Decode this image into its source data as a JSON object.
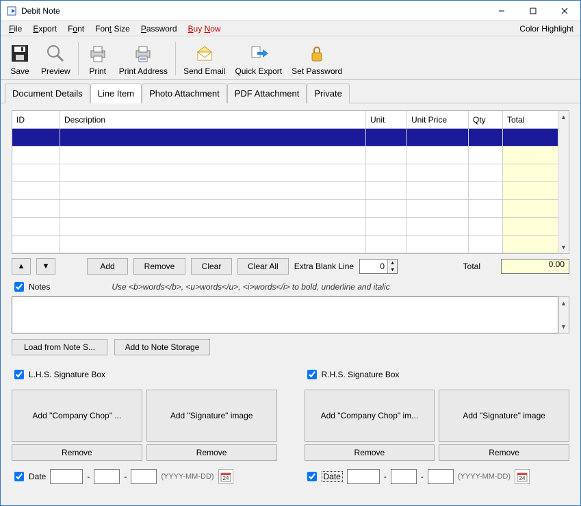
{
  "window": {
    "title": "Debit Note"
  },
  "menu": {
    "file": "File",
    "export": "Export",
    "font": "Font",
    "font_size": "Font Size",
    "password": "Password",
    "buy_now": "Buy Now",
    "color_highlight": "Color Highlight"
  },
  "toolbar": {
    "save": "Save",
    "preview": "Preview",
    "print": "Print",
    "print_address": "Print Address",
    "send_email": "Send Email",
    "quick_export": "Quick Export",
    "set_password": "Set Password"
  },
  "tabs": {
    "doc_details": "Document Details",
    "line_item": "Line Item",
    "photo": "Photo Attachment",
    "pdf": "PDF Attachment",
    "private": "Private"
  },
  "grid": {
    "h_id": "ID",
    "h_desc": "Description",
    "h_unit": "Unit",
    "h_uprice": "Unit Price",
    "h_qty": "Qty",
    "h_total": "Total"
  },
  "rowbar": {
    "add": "Add",
    "remove": "Remove",
    "clear": "Clear",
    "clear_all": "Clear All",
    "extra_blank": "Extra Blank Line",
    "extra_blank_val": "0",
    "total_label": "Total",
    "total_val": "0.00"
  },
  "notes": {
    "cb": "Notes",
    "hint": "Use <b>words</b>, <u>words</u>, <i>words</i> to bold, underline and italic",
    "load": "Load from Note S...",
    "addstore": "Add to Note Storage"
  },
  "sig": {
    "lhs_cb": "L.H.S. Signature Box",
    "rhs_cb": "R.H.S. Signature Box",
    "add_chop_l": "Add \"Company Chop\" ...",
    "add_chop_r": "Add \"Company Chop\" im...",
    "add_sig": "Add \"Signature\" image",
    "remove": "Remove",
    "date": "Date",
    "date_hint": "(YYYY-MM-DD)"
  }
}
